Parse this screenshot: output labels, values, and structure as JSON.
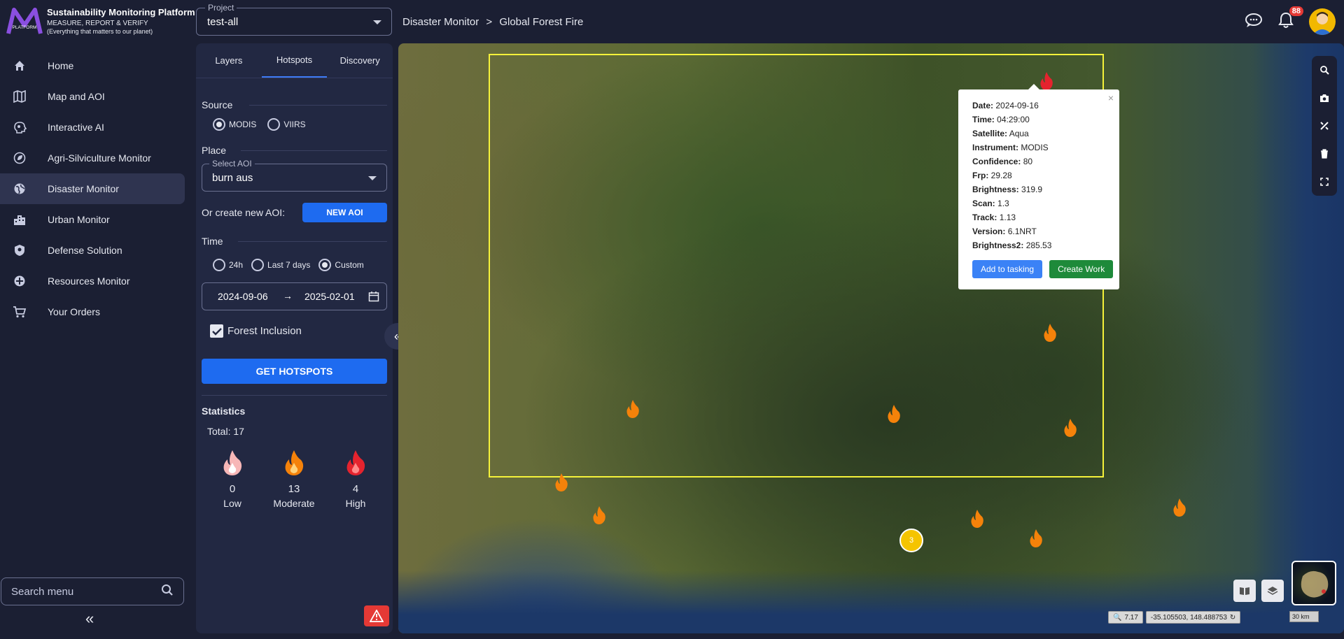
{
  "app": {
    "title": "Sustainability Monitoring Platform",
    "tagline": "MEASURE, REPORT & VERIFY",
    "subtitle": "(Everything that matters to our planet)",
    "logo_text": "PLATFORM"
  },
  "project": {
    "label": "Project",
    "value": "test-all"
  },
  "breadcrumb": {
    "parent": "Disaster Monitor",
    "separator": ">",
    "current": "Global Forest Fire"
  },
  "notifications": {
    "count": "88"
  },
  "sidebar": {
    "items": [
      {
        "label": "Home",
        "icon": "home-icon"
      },
      {
        "label": "Map and AOI",
        "icon": "map-icon"
      },
      {
        "label": "Interactive AI",
        "icon": "ai-icon"
      },
      {
        "label": "Agri-Silviculture Monitor",
        "icon": "leaf-icon"
      },
      {
        "label": "Disaster Monitor",
        "icon": "globe-icon"
      },
      {
        "label": "Urban Monitor",
        "icon": "building-icon"
      },
      {
        "label": "Defense Solution",
        "icon": "shield-icon"
      },
      {
        "label": "Resources Monitor",
        "icon": "resources-icon"
      },
      {
        "label": "Your Orders",
        "icon": "cart-icon"
      }
    ],
    "active_index": 4,
    "search_placeholder": "Search menu"
  },
  "panel": {
    "tabs": [
      "Layers",
      "Hotspots",
      "Discovery"
    ],
    "active_tab": 1,
    "source_label": "Source",
    "source_options": [
      "MODIS",
      "VIIRS"
    ],
    "source_selected": "MODIS",
    "place_label": "Place",
    "aoi_label": "Select AOI",
    "aoi_value": "burn aus",
    "create_aoi_label": "Or create new AOI:",
    "new_aoi_button": "NEW AOI",
    "time_label": "Time",
    "time_options": [
      "24h",
      "Last 7 days",
      "Custom"
    ],
    "time_selected": "Custom",
    "date_from": "2024-09-06",
    "date_arrow": "→",
    "date_to": "2025-02-01",
    "forest_inclusion": "Forest Inclusion",
    "forest_checked": true,
    "get_hotspots_button": "GET HOTSPOTS",
    "statistics_label": "Statistics",
    "total": "Total: 17",
    "stats": [
      {
        "count": "0",
        "label": "Low",
        "color": "#f7b7b7"
      },
      {
        "count": "13",
        "label": "Moderate",
        "color": "#f5820a"
      },
      {
        "count": "4",
        "label": "High",
        "color": "#e5232e"
      }
    ]
  },
  "popup": {
    "rows": [
      {
        "key": "Date:",
        "value": "2024-09-16"
      },
      {
        "key": "Time:",
        "value": "04:29:00"
      },
      {
        "key": "Satellite:",
        "value": "Aqua"
      },
      {
        "key": "Instrument:",
        "value": "MODIS"
      },
      {
        "key": "Confidence:",
        "value": "80"
      },
      {
        "key": "Frp:",
        "value": "29.28"
      },
      {
        "key": "Brightness:",
        "value": "319.9"
      },
      {
        "key": "Scan:",
        "value": "1.3"
      },
      {
        "key": "Track:",
        "value": "1.13"
      },
      {
        "key": "Version:",
        "value": "6.1NRT"
      },
      {
        "key": "Brightness2:",
        "value": "285.53"
      }
    ],
    "close": "×",
    "add_to_tasking": "Add to tasking",
    "create_work": "Create Work"
  },
  "map": {
    "cluster_count": "3",
    "zoom": "7.17",
    "coords": "-35.105503,  148.488753",
    "scale": "30 km",
    "colors": {
      "aoi_border": "#f5f23a",
      "fire": "#f5820a",
      "fire_high": "#e5232e"
    }
  }
}
